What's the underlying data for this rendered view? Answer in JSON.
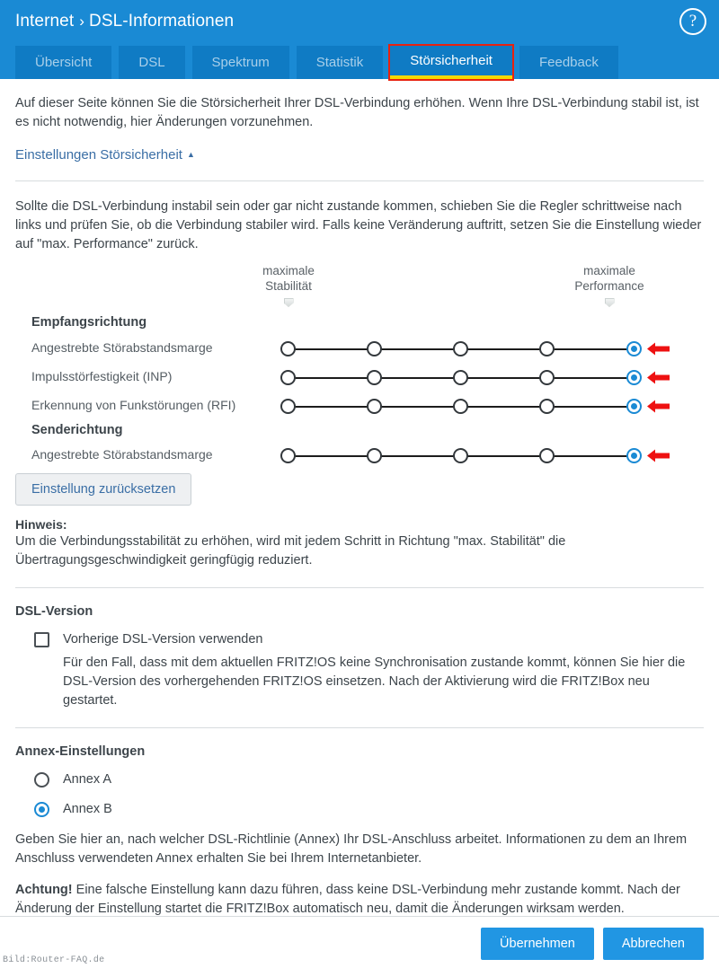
{
  "header": {
    "breadcrumb_root": "Internet",
    "breadcrumb_sep": "›",
    "breadcrumb_page": "DSL-Informationen",
    "help_icon_label": "?",
    "bg_color": "#1a8ad4",
    "tabs": [
      {
        "label": "Übersicht",
        "active": false
      },
      {
        "label": "DSL",
        "active": false
      },
      {
        "label": "Spektrum",
        "active": false
      },
      {
        "label": "Statistik",
        "active": false
      },
      {
        "label": "Störsicherheit",
        "active": true
      },
      {
        "label": "Feedback",
        "active": false
      }
    ],
    "active_tab_underline_color": "#f5d800",
    "annotation_box_color": "#e8220f"
  },
  "intro": {
    "text": "Auf dieser Seite können Sie die Störsicherheit Ihrer DSL-Verbindung erhöhen. Wenn Ihre DSL-Verbindung stabil ist, ist es nicht notwendig, hier Änderungen vorzunehmen.",
    "accordion_label": "Einstellungen Störsicherheit",
    "accordion_caret": "▲"
  },
  "sliders": {
    "instruction": "Sollte die DSL-Verbindung instabil sein oder gar nicht zustande kommen, schieben Sie die Regler schrittweise nach links und prüfen Sie, ob die Verbindung stabiler wird. Falls keine Veränderung auftritt, setzen Sie die Einstellung wieder auf \"max. Performance\" zurück.",
    "scale_left_line1": "maximale",
    "scale_left_line2": "Stabilität",
    "scale_right_line1": "maximale",
    "scale_right_line2": "Performance",
    "group_receive": "Empfangsrichtung",
    "group_send": "Senderichtung",
    "steps": 5,
    "rows": [
      {
        "label": "Angestrebte Störabstandsmarge",
        "selected_step": 5,
        "group": "Empfangsrichtung",
        "arrow": true
      },
      {
        "label": "Impulsstörfestigkeit (INP)",
        "selected_step": 5,
        "group": "Empfangsrichtung",
        "arrow": true
      },
      {
        "label": "Erkennung von Funkstörungen (RFI)",
        "selected_step": 5,
        "group": "Empfangsrichtung",
        "arrow": true
      },
      {
        "label": "Angestrebte Störabstandsmarge",
        "selected_step": 5,
        "group": "Senderichtung",
        "arrow": true
      }
    ],
    "selected_color": "#1a8ad4",
    "arrow_color": "#ee1111",
    "reset_button": "Einstellung zurücksetzen",
    "note_title": "Hinweis:",
    "note_text": "Um die Verbindungsstabilität zu erhöhen, wird mit jedem Schritt in Richtung \"max. Stabilität\" die Übertragungsgeschwindigkeit geringfügig reduziert."
  },
  "dsl_version": {
    "heading": "DSL-Version",
    "checkbox_label": "Vorherige DSL-Version verwenden",
    "checkbox_checked": false,
    "description": "Für den Fall, dass mit dem aktuellen FRITZ!OS keine Synchronisation zustande kommt, können Sie hier die DSL-Version des vorhergehenden FRITZ!OS einsetzen. Nach der Aktivierung wird die FRITZ!Box neu gestartet."
  },
  "annex": {
    "heading": "Annex-Einstellungen",
    "options": [
      {
        "label": "Annex A",
        "selected": false
      },
      {
        "label": "Annex B",
        "selected": true
      }
    ],
    "description": "Geben Sie hier an, nach welcher DSL-Richtlinie (Annex) Ihr DSL-Anschluss arbeitet. Informationen zu dem an Ihrem Anschluss verwendeten Annex erhalten Sie bei Ihrem Internetanbieter.",
    "warning_label": "Achtung!",
    "warning_text": " Eine falsche Einstellung kann dazu führen, dass keine DSL-Verbindung mehr zustande kommt. Nach der Änderung der Einstellung startet die FRITZ!Box automatisch neu, damit die Änderungen wirksam werden."
  },
  "footer": {
    "apply_label": "Übernehmen",
    "cancel_label": "Abbrechen",
    "button_color": "#2196e3"
  },
  "watermark": "Bild:Router-FAQ.de"
}
